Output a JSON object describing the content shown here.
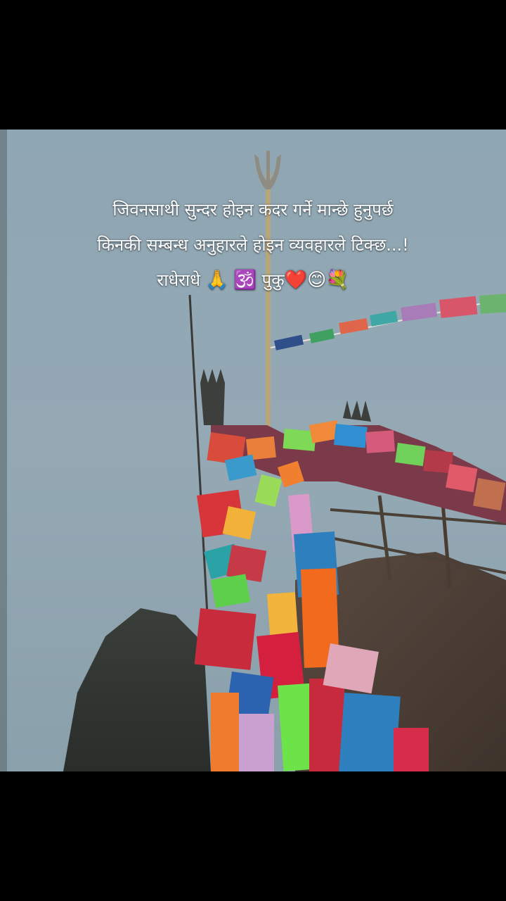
{
  "caption": {
    "line1": "जिवनसाथी सुन्दर होइन कदर गर्ने मान्छे हुनुपर्छ",
    "line2": "किनकी सम्बन्ध अनुहारले होइन व्यवहारले टिक्छ...!",
    "line3_text": "राधेराधे",
    "line3_emoji_pray": "🙏",
    "line3_om": "🕉️",
    "line3_name": "पुकु",
    "line3_emoji_tail": "❤️😊💐"
  },
  "colors": {
    "letterbox": "#000000",
    "sky_fog": "#93a8b3",
    "caption_text": "#ffffff"
  }
}
